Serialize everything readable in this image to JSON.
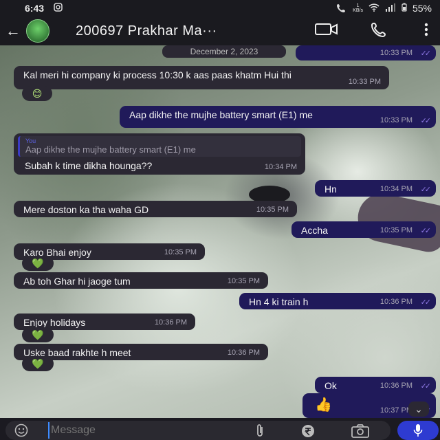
{
  "status_bar": {
    "time": "6:43",
    "kbs_value": "1",
    "kbs_unit": "KB/s",
    "battery": "55%"
  },
  "header": {
    "contact_name": "200697 Prakhar Ma···"
  },
  "date_separator": "December 2, 2023",
  "messages": [
    {
      "dir": "out",
      "text": "",
      "time": "10:33 PM"
    },
    {
      "dir": "in",
      "text": "Kal meri hi company ki process 10:30 k aas paas khatm Hui thi",
      "time": "10:33 PM",
      "reaction": "😊"
    },
    {
      "dir": "out",
      "text": "Aap dikhe the mujhe battery smart (E1) me",
      "time": "10:33 PM"
    },
    {
      "dir": "in",
      "reply_name": "You",
      "reply_text": "Aap dikhe the mujhe battery smart (E1) me",
      "text": "Subah k time dikha hounga??",
      "time": "10:34 PM"
    },
    {
      "dir": "out",
      "text": "Hn",
      "time": "10:34 PM"
    },
    {
      "dir": "in",
      "text": "Mere doston ka tha waha GD",
      "time": "10:35 PM"
    },
    {
      "dir": "out",
      "text": "Accha",
      "time": "10:35 PM"
    },
    {
      "dir": "in",
      "text": "Karo Bhai enjoy",
      "time": "10:35 PM",
      "reaction": "💚"
    },
    {
      "dir": "in",
      "text": "Ab toh Ghar hi jaoge tum",
      "time": "10:35 PM"
    },
    {
      "dir": "out",
      "text": "Hn 4 ki train h",
      "time": "10:36 PM"
    },
    {
      "dir": "in",
      "text": "Enjoy holidays",
      "time": "10:36 PM",
      "reaction": "💚"
    },
    {
      "dir": "in",
      "text": "Uske baad rakhte h meet",
      "time": "10:36 PM",
      "reaction": "💚"
    },
    {
      "dir": "out",
      "text": "Ok",
      "time": "10:36 PM"
    },
    {
      "dir": "out",
      "text": "👍",
      "time": "10:37 PM"
    }
  ],
  "composer": {
    "placeholder": "Message"
  },
  "colors": {
    "incoming": "#2b2833",
    "outgoing": "#201a5a",
    "read_ticks": "#8f7ae6",
    "mic_button": "#2e3bd1"
  }
}
